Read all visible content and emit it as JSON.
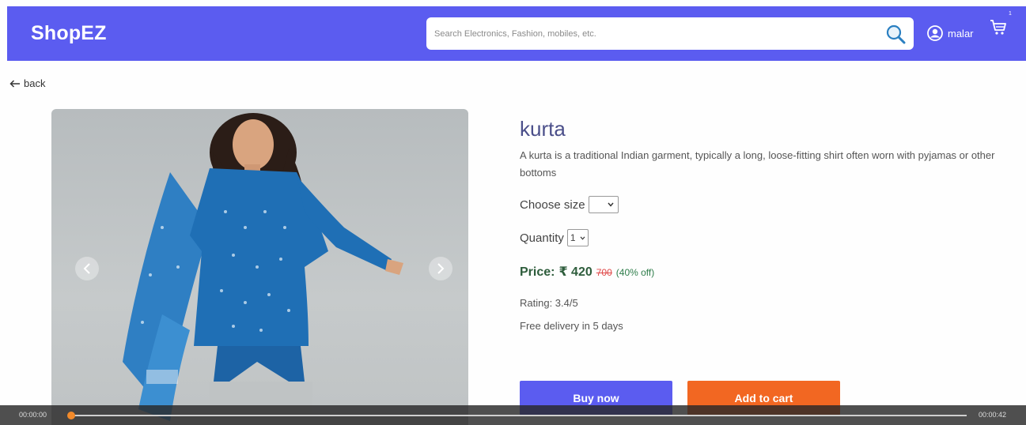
{
  "header": {
    "brand": "ShopEZ",
    "search_placeholder": "Search Electronics, Fashion, mobiles, etc.",
    "user_name": "malar",
    "cart_count": "1",
    "background_color": "#5b5cf0"
  },
  "nav": {
    "back_label": "back"
  },
  "product": {
    "title": "kurta",
    "description": "A kurta is a traditional Indian garment, typically a long, loose-fitting shirt often worn with pyjamas or other bottoms",
    "size_label": "Choose size",
    "size_value": "",
    "quantity_label": "Quantity",
    "quantity_value": "1",
    "price_label": "Price:",
    "price_value": "₹ 420",
    "price_old": "700",
    "price_discount": "(40% off)",
    "rating": "Rating: 3.4/5",
    "delivery": "Free delivery in 5 days",
    "buy_label": "Buy now",
    "add_to_cart_label": "Add to cart"
  },
  "video": {
    "current_time": "00:00:00",
    "total_time": "00:00:42",
    "progress": 0.0
  },
  "colors": {
    "accent": "#5b5cf0",
    "buy_button": "#5b5cf0",
    "add_to_cart_button": "#f26722",
    "title": "#4b4f8a",
    "price": "#2e5d3c",
    "old_price": "#e04a4a"
  },
  "icons": [
    "search-icon",
    "user-circle-icon",
    "cart-icon",
    "arrow-left-icon",
    "chevron-left-icon",
    "chevron-right-icon",
    "chevron-down-icon"
  ]
}
